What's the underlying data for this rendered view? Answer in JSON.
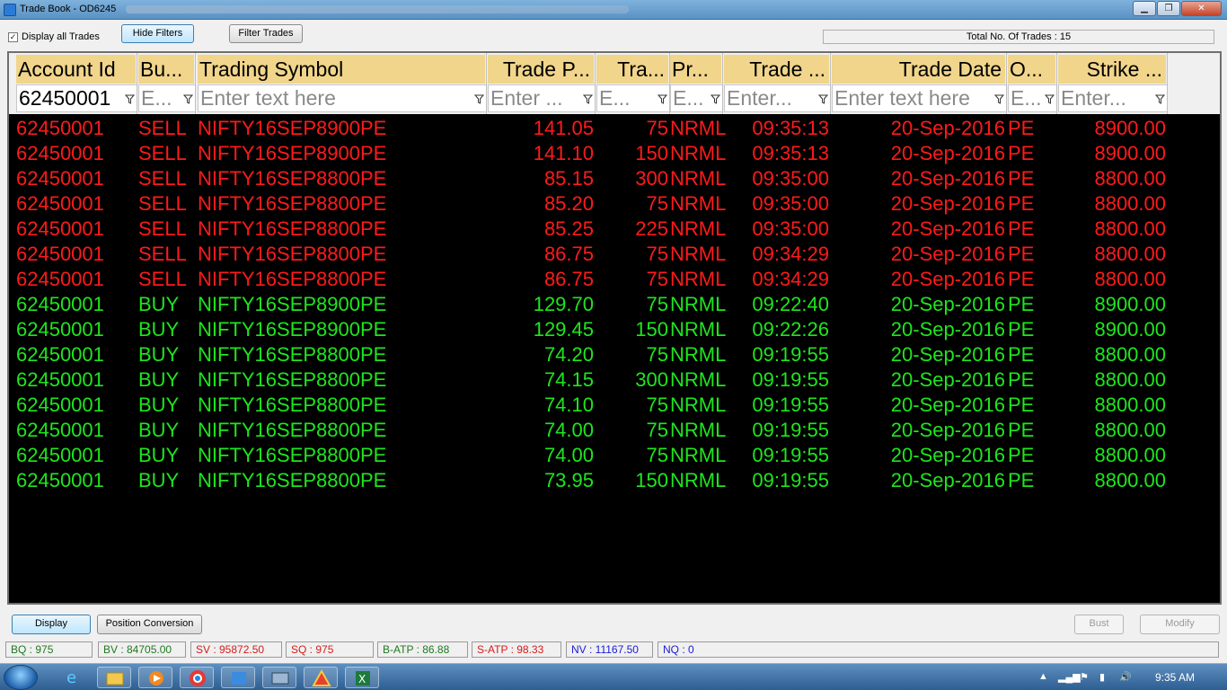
{
  "window": {
    "title": "Trade Book - OD6245",
    "controls": [
      "minimize",
      "maximize",
      "close"
    ]
  },
  "toolbar": {
    "display_all_trades_label": "Display all Trades",
    "display_all_trades_checked": true,
    "hide_filters_label": "Hide Filters",
    "filter_trades_label": "Filter Trades",
    "total_trades_label": "Total No. Of Trades : 15"
  },
  "grid": {
    "columns": [
      {
        "header": "Account Id",
        "filter": "62450001"
      },
      {
        "header": "Bu...",
        "filter": "E..."
      },
      {
        "header": "Trading Symbol",
        "filter": "Enter text here"
      },
      {
        "header": "Trade P...",
        "filter": "Enter ..."
      },
      {
        "header": "Tra...",
        "filter": "E..."
      },
      {
        "header": "Pr...",
        "filter": "E..."
      },
      {
        "header": "Trade ...",
        "filter": "Enter..."
      },
      {
        "header": "Trade Date",
        "filter": "Enter text here"
      },
      {
        "header": "O...",
        "filter": "E..."
      },
      {
        "header": "Strike ...",
        "filter": "Enter..."
      }
    ],
    "colors": {
      "sell": "#ff1a1a",
      "buy": "#1ee61e",
      "header_bg": "#f0d58b",
      "grid_bg": "#000000"
    },
    "rows": [
      {
        "account": "62450001",
        "side": "SELL",
        "symbol": "NIFTY16SEP8900PE",
        "price": "141.05",
        "qty": "75",
        "product": "NRML",
        "time": "09:35:13",
        "date": "20-Sep-2016",
        "opt": "PE",
        "strike": "8900.00"
      },
      {
        "account": "62450001",
        "side": "SELL",
        "symbol": "NIFTY16SEP8900PE",
        "price": "141.10",
        "qty": "150",
        "product": "NRML",
        "time": "09:35:13",
        "date": "20-Sep-2016",
        "opt": "PE",
        "strike": "8900.00"
      },
      {
        "account": "62450001",
        "side": "SELL",
        "symbol": "NIFTY16SEP8800PE",
        "price": "85.15",
        "qty": "300",
        "product": "NRML",
        "time": "09:35:00",
        "date": "20-Sep-2016",
        "opt": "PE",
        "strike": "8800.00"
      },
      {
        "account": "62450001",
        "side": "SELL",
        "symbol": "NIFTY16SEP8800PE",
        "price": "85.20",
        "qty": "75",
        "product": "NRML",
        "time": "09:35:00",
        "date": "20-Sep-2016",
        "opt": "PE",
        "strike": "8800.00"
      },
      {
        "account": "62450001",
        "side": "SELL",
        "symbol": "NIFTY16SEP8800PE",
        "price": "85.25",
        "qty": "225",
        "product": "NRML",
        "time": "09:35:00",
        "date": "20-Sep-2016",
        "opt": "PE",
        "strike": "8800.00"
      },
      {
        "account": "62450001",
        "side": "SELL",
        "symbol": "NIFTY16SEP8800PE",
        "price": "86.75",
        "qty": "75",
        "product": "NRML",
        "time": "09:34:29",
        "date": "20-Sep-2016",
        "opt": "PE",
        "strike": "8800.00"
      },
      {
        "account": "62450001",
        "side": "SELL",
        "symbol": "NIFTY16SEP8800PE",
        "price": "86.75",
        "qty": "75",
        "product": "NRML",
        "time": "09:34:29",
        "date": "20-Sep-2016",
        "opt": "PE",
        "strike": "8800.00"
      },
      {
        "account": "62450001",
        "side": "BUY",
        "symbol": "NIFTY16SEP8900PE",
        "price": "129.70",
        "qty": "75",
        "product": "NRML",
        "time": "09:22:40",
        "date": "20-Sep-2016",
        "opt": "PE",
        "strike": "8900.00"
      },
      {
        "account": "62450001",
        "side": "BUY",
        "symbol": "NIFTY16SEP8900PE",
        "price": "129.45",
        "qty": "150",
        "product": "NRML",
        "time": "09:22:26",
        "date": "20-Sep-2016",
        "opt": "PE",
        "strike": "8900.00"
      },
      {
        "account": "62450001",
        "side": "BUY",
        "symbol": "NIFTY16SEP8800PE",
        "price": "74.20",
        "qty": "75",
        "product": "NRML",
        "time": "09:19:55",
        "date": "20-Sep-2016",
        "opt": "PE",
        "strike": "8800.00"
      },
      {
        "account": "62450001",
        "side": "BUY",
        "symbol": "NIFTY16SEP8800PE",
        "price": "74.15",
        "qty": "300",
        "product": "NRML",
        "time": "09:19:55",
        "date": "20-Sep-2016",
        "opt": "PE",
        "strike": "8800.00"
      },
      {
        "account": "62450001",
        "side": "BUY",
        "symbol": "NIFTY16SEP8800PE",
        "price": "74.10",
        "qty": "75",
        "product": "NRML",
        "time": "09:19:55",
        "date": "20-Sep-2016",
        "opt": "PE",
        "strike": "8800.00"
      },
      {
        "account": "62450001",
        "side": "BUY",
        "symbol": "NIFTY16SEP8800PE",
        "price": "74.00",
        "qty": "75",
        "product": "NRML",
        "time": "09:19:55",
        "date": "20-Sep-2016",
        "opt": "PE",
        "strike": "8800.00"
      },
      {
        "account": "62450001",
        "side": "BUY",
        "symbol": "NIFTY16SEP8800PE",
        "price": "74.00",
        "qty": "75",
        "product": "NRML",
        "time": "09:19:55",
        "date": "20-Sep-2016",
        "opt": "PE",
        "strike": "8800.00"
      },
      {
        "account": "62450001",
        "side": "BUY",
        "symbol": "NIFTY16SEP8800PE",
        "price": "73.95",
        "qty": "150",
        "product": "NRML",
        "time": "09:19:55",
        "date": "20-Sep-2016",
        "opt": "PE",
        "strike": "8800.00"
      }
    ]
  },
  "bottom_buttons": {
    "display_label": "Display",
    "position_conversion_label": "Position Conversion",
    "bust_label": "Bust",
    "modify_label": "Modify"
  },
  "status": [
    {
      "text": "BQ : 975",
      "color": "#1f7a1f"
    },
    {
      "text": "BV : 84705.00",
      "color": "#1f7a1f"
    },
    {
      "text": "SV : 95872.50",
      "color": "#d41c1c"
    },
    {
      "text": "SQ : 975",
      "color": "#d41c1c"
    },
    {
      "text": "B-ATP : 86.88",
      "color": "#1f7a1f"
    },
    {
      "text": "S-ATP : 98.33",
      "color": "#d41c1c"
    },
    {
      "text": "NV : 11167.50",
      "color": "#1a1ad4"
    },
    {
      "text": "NQ : 0",
      "color": "#1a1ad4"
    }
  ],
  "taskbar": {
    "pinned_icons": [
      "start-orb-icon",
      "internet-explorer-icon",
      "file-explorer-icon",
      "media-player-icon",
      "chrome-icon",
      "app-puzzle-icon",
      "app-window-icon",
      "app-triangle-icon",
      "excel-icon"
    ],
    "clock": "9:35 AM"
  }
}
